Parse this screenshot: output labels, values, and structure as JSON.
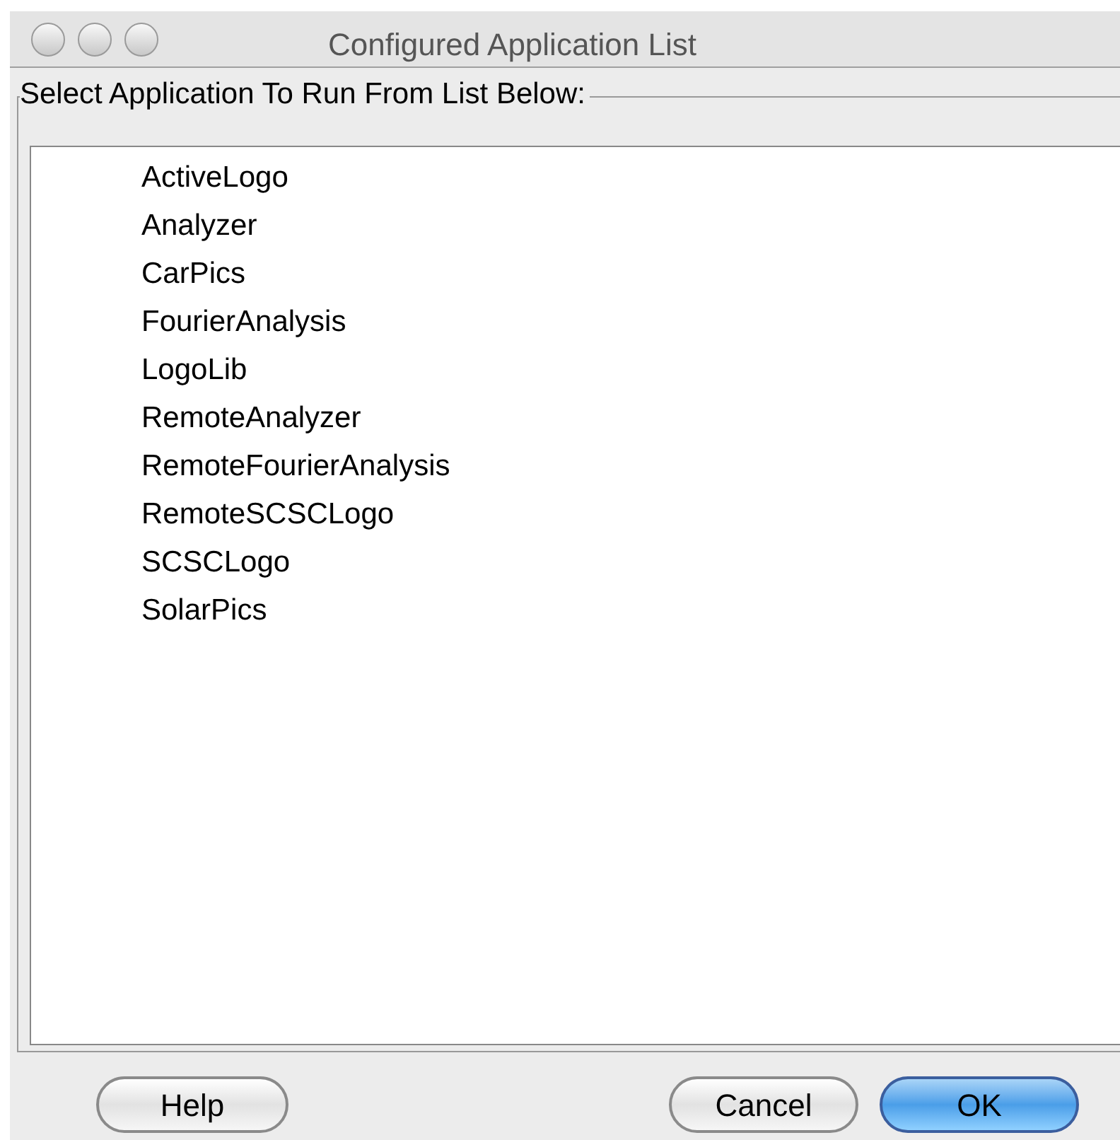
{
  "window": {
    "title": "Configured Application List"
  },
  "group": {
    "label": "Select Application To Run From List Below:"
  },
  "applications": [
    {
      "name": "ActiveLogo"
    },
    {
      "name": "Analyzer"
    },
    {
      "name": "CarPics"
    },
    {
      "name": "FourierAnalysis"
    },
    {
      "name": "LogoLib"
    },
    {
      "name": "RemoteAnalyzer"
    },
    {
      "name": "RemoteFourierAnalysis"
    },
    {
      "name": "RemoteSCSCLogo"
    },
    {
      "name": "SCSCLogo"
    },
    {
      "name": "SolarPics"
    }
  ],
  "buttons": [
    {
      "label": "Help",
      "default": false
    },
    {
      "label": "Cancel",
      "default": false
    },
    {
      "label": "OK",
      "default": true
    }
  ]
}
